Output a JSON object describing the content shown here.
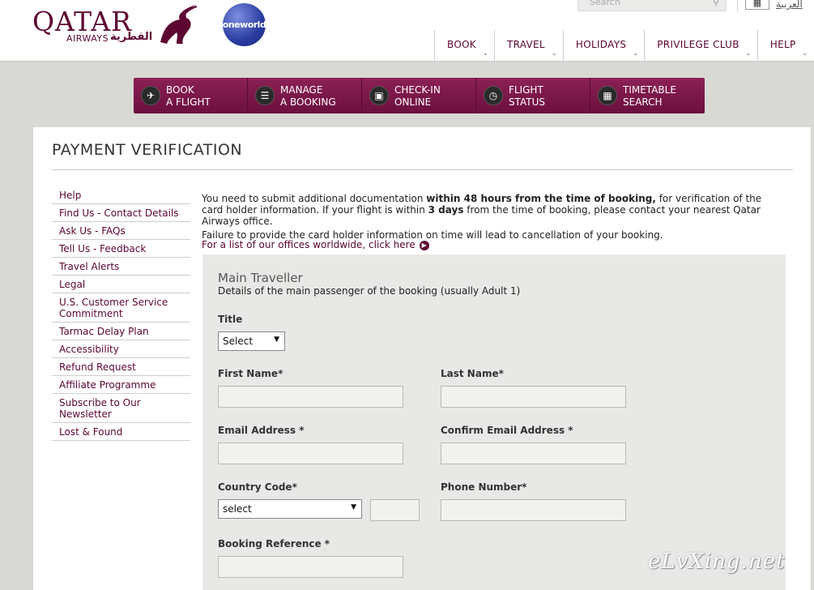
{
  "header": {
    "logo_text": "QATAR",
    "logo_sub": "AIRWAYS",
    "logo_arabic": "القطرية",
    "oneworld": "oneworld",
    "search_placeholder": "Search",
    "language_link": "العربية",
    "nav": [
      "BOOK",
      "TRAVEL",
      "HOLIDAYS",
      "PRIVILEGE CLUB",
      "HELP"
    ]
  },
  "quickbar": [
    {
      "line1": "BOOK",
      "line2": "A FLIGHT",
      "icon": "plane-icon"
    },
    {
      "line1": "MANAGE",
      "line2": "A BOOKING",
      "icon": "list-icon"
    },
    {
      "line1": "CHECK-IN",
      "line2": "ONLINE",
      "icon": "luggage-icon"
    },
    {
      "line1": "FLIGHT",
      "line2": "STATUS",
      "icon": "clock-icon"
    },
    {
      "line1": "TIMETABLE",
      "line2": "SEARCH",
      "icon": "calendar-icon"
    }
  ],
  "page_title": "PAYMENT VERIFICATION",
  "sidenav": [
    "Help",
    "Find Us - Contact Details",
    "Ask Us - FAQs",
    "Tell Us - Feedback",
    "Travel Alerts",
    "Legal",
    "U.S. Customer Service Commitment",
    "Tarmac Delay Plan",
    "Accessibility",
    "Refund Request",
    "Affiliate Programme",
    "Subscribe to Our Newsletter",
    "Lost & Found"
  ],
  "intro": {
    "p1_a": "You need to submit additional documentation ",
    "p1_b": "within 48 hours from the time of booking,",
    "p1_c": " for verification of the card holder information. If your flight is within ",
    "p1_d": "3 days",
    "p1_e": " from the time of booking, please contact your nearest Qatar Airways office.",
    "p2": "Failure to provide the card holder information on time will lead to cancellation of your booking.",
    "offices_link": "For a list of our offices worldwide, click here"
  },
  "form": {
    "section_title": "Main Traveller",
    "section_desc": "Details of the main passenger of the booking (usually Adult 1)",
    "title_label": "Title",
    "title_value": "Select",
    "first_name_label": "First Name*",
    "last_name_label": "Last Name*",
    "email_label": "Email Address *",
    "confirm_email_label": "Confirm Email Address *",
    "country_code_label": "Country Code*",
    "country_code_value": "select",
    "phone_label": "Phone Number*",
    "booking_ref_label": "Booking Reference *"
  },
  "watermark": "eLvXing.net",
  "colors": {
    "brand": "#5c0632",
    "quickbar": "#7a1748",
    "panel": "#e8e8e6"
  }
}
